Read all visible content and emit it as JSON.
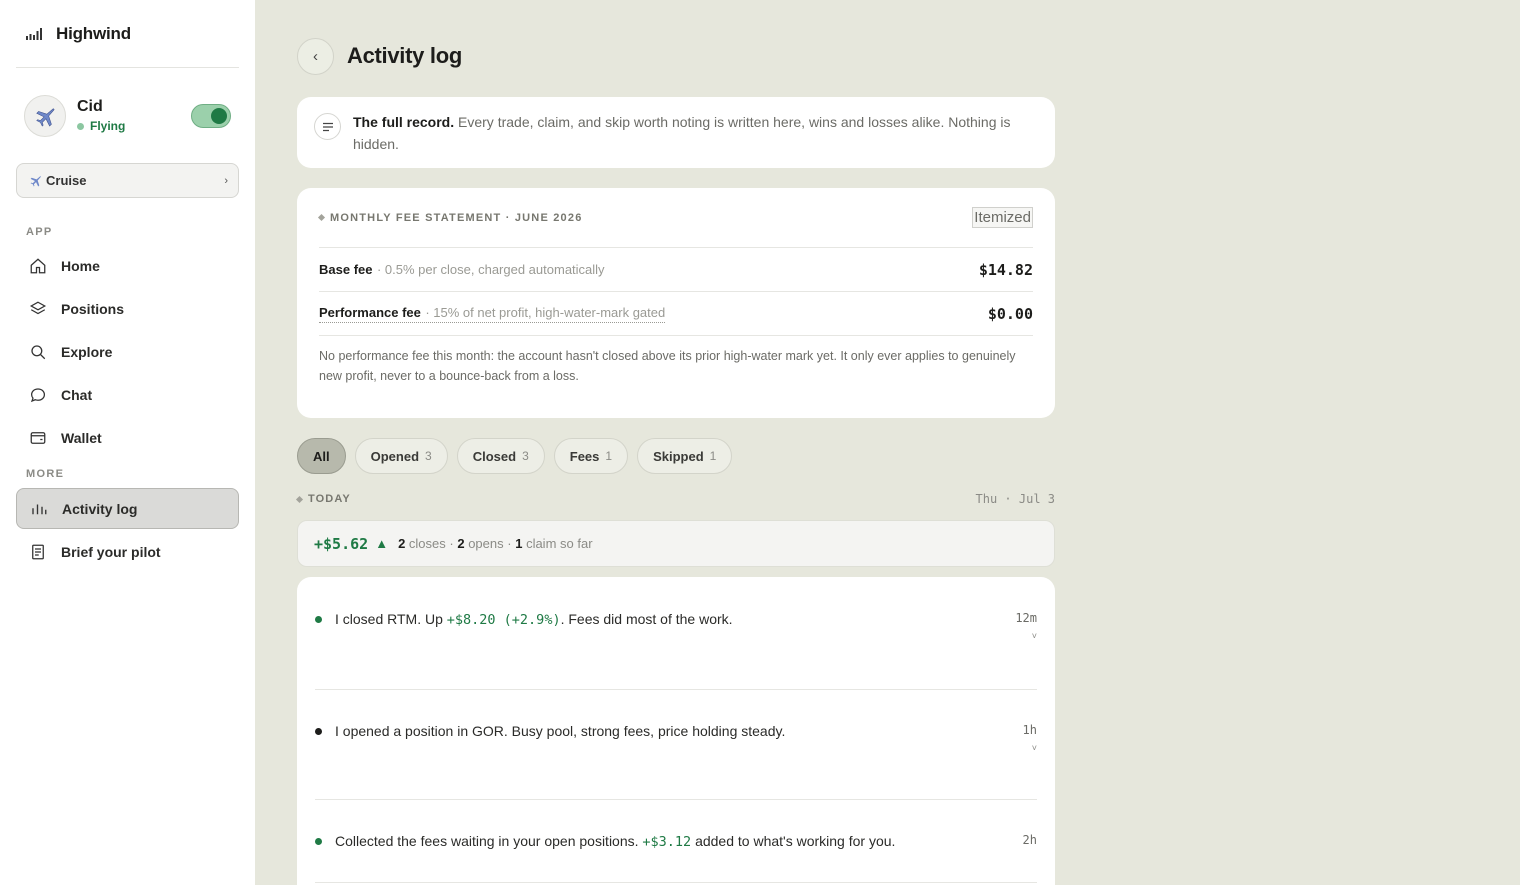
{
  "brand": {
    "name": "Highwind"
  },
  "pilot": {
    "name": "Cid",
    "status": "Flying",
    "mode": "Cruise"
  },
  "nav": {
    "app_label": "APP",
    "more_label": "MORE",
    "items": [
      {
        "label": "Home",
        "icon": "home-icon"
      },
      {
        "label": "Positions",
        "icon": "layers-icon"
      },
      {
        "label": "Explore",
        "icon": "search-icon"
      },
      {
        "label": "Chat",
        "icon": "chat-icon"
      },
      {
        "label": "Wallet",
        "icon": "wallet-icon"
      }
    ],
    "more_items": [
      {
        "label": "Activity log",
        "icon": "bars-icon",
        "active": true
      },
      {
        "label": "Brief your pilot",
        "icon": "document-icon"
      }
    ]
  },
  "header": {
    "title": "Activity log",
    "back_icon": "chevron-left-icon"
  },
  "note": {
    "bold": "The full record.",
    "text": "Every trade, claim, and skip worth noting is written here, wins and losses alike. Nothing is hidden."
  },
  "statement": {
    "title": "MONTHLY FEE STATEMENT · JUNE 2026",
    "itemized_label": "Itemized",
    "rows": [
      {
        "name": "Base fee",
        "desc": "· 0.5% per close, charged automatically",
        "amount": "$14.82"
      },
      {
        "name": "Performance fee",
        "desc": "· 15% of net profit, high-water-mark gated",
        "amount": "$0.00"
      }
    ],
    "note": "No performance fee this month: the account hasn't closed above its prior high-water mark yet. It only ever applies to genuinely new profit, never to a bounce-back from a loss."
  },
  "filters": [
    {
      "label": "All",
      "count": "",
      "active": true
    },
    {
      "label": "Opened",
      "count": "3"
    },
    {
      "label": "Closed",
      "count": "3"
    },
    {
      "label": "Fees",
      "count": "1"
    },
    {
      "label": "Skipped",
      "count": "1"
    }
  ],
  "day": {
    "label": "TODAY",
    "date": "Thu · Jul 3",
    "summary_value": "+$5.62",
    "summary_arrow": "▲",
    "closes_n": "2",
    "closes_label": "closes ·",
    "opens_n": "2",
    "opens_label": "opens ·",
    "claims_n": "1",
    "claims_label": "claim so far"
  },
  "events": [
    {
      "pre": "I closed RTM. Up",
      "value": "+$8.20 (+2.9%)",
      "post": ". Fees did most of the work.",
      "time": "12m",
      "expand": "˅"
    },
    {
      "pre": "I opened a position in GOR. Busy pool, strong fees, price holding steady.",
      "value": "",
      "post": "",
      "time": "1h",
      "expand": "˅"
    },
    {
      "pre": "Collected the fees waiting in your open positions.",
      "value": "+$3.12",
      "post": "added to what's working for you.",
      "time": "2h",
      "expand": ""
    }
  ],
  "colors": {
    "accent_green": "#1f7a45",
    "background": "#e6e7dc",
    "sidebar": "#ffffff"
  }
}
